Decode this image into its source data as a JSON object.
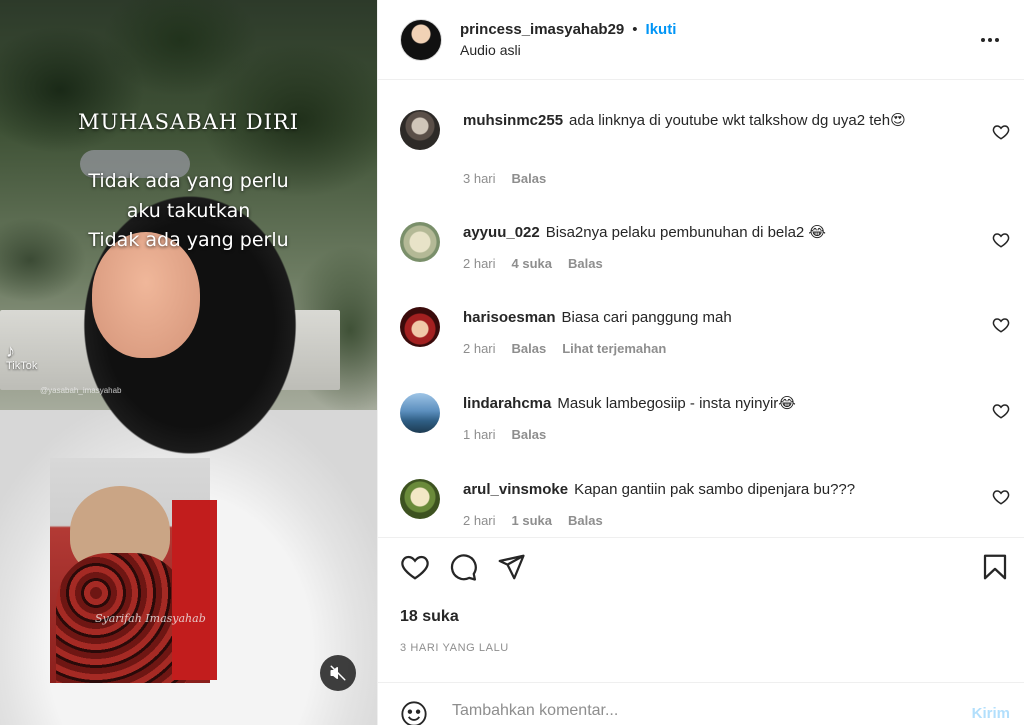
{
  "post": {
    "username": "princess_imasyahab29",
    "separator": "•",
    "follow_label": "Ikuti",
    "audio_label": "Audio asli",
    "more_icon": "more-horizontal-icon"
  },
  "media": {
    "title": "MUHASABAH DIRI",
    "lines": [
      "Tidak ada yang perlu",
      "aku takutkan",
      "Tidak ada yang perlu"
    ],
    "tiktok_label": "TikTok",
    "tiktok_handle": "@yasabah_imasyahab",
    "photo_caption": "Syarifah Imasyahab",
    "mute_icon": "speaker-muted-icon"
  },
  "comments": [
    {
      "user": "muhsinmc255",
      "text": "ada linknya di youtube wkt talkshow dg uya2 teh😍",
      "time": "3 hari",
      "likes": "",
      "reply": "Balas",
      "translate": ""
    },
    {
      "user": "ayyuu_022",
      "text": "Bisa2nya pelaku pembunuhan di bela2 😂",
      "time": "2 hari",
      "likes": "4 suka",
      "reply": "Balas",
      "translate": ""
    },
    {
      "user": "harisoesman",
      "text": "Biasa cari panggung mah",
      "time": "2 hari",
      "likes": "",
      "reply": "Balas",
      "translate": "Lihat terjemahan"
    },
    {
      "user": "lindarahcma",
      "text": "Masuk lambegosiip - insta nyinyir😂",
      "time": "1 hari",
      "likes": "",
      "reply": "Balas",
      "translate": ""
    },
    {
      "user": "arul_vinsmoke",
      "text": "Kapan gantiin pak sambo dipenjara bu???",
      "time": "2 hari",
      "likes": "1 suka",
      "reply": "Balas",
      "translate": ""
    }
  ],
  "actions": {
    "like_icon": "heart-icon",
    "comment_icon": "comment-icon",
    "share_icon": "send-icon",
    "save_icon": "bookmark-icon"
  },
  "likes_label": "18 suka",
  "date_label": "3 HARI YANG LALU",
  "compose": {
    "emoji_icon": "emoji-icon",
    "placeholder": "Tambahkan komentar...",
    "send_label": "Kirim"
  },
  "colors": {
    "accent": "#0095f6",
    "send_disabled": "#b2dffc",
    "muted_text": "#8e8e8e"
  }
}
